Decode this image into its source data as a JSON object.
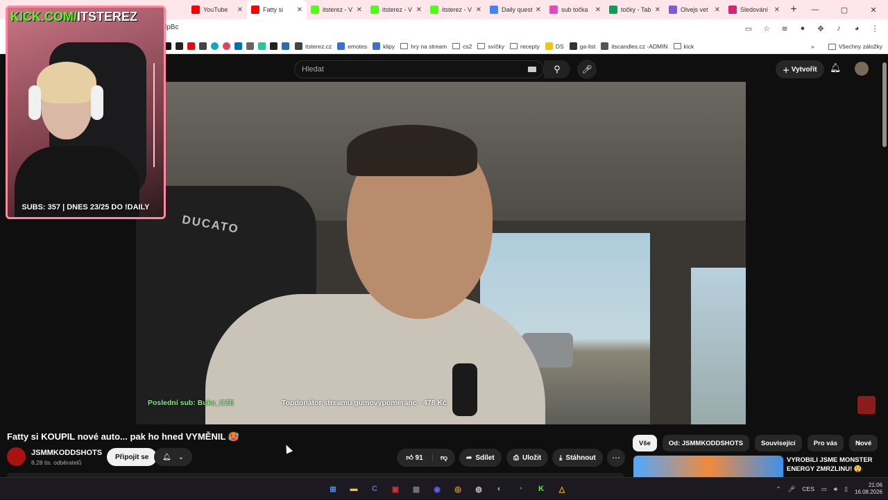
{
  "browser": {
    "tabs": [
      {
        "label": "YouTube",
        "icon": "youtube-icon",
        "color": "#ff0000",
        "active": false
      },
      {
        "label": "Fatty si",
        "icon": "youtube-icon",
        "color": "#ff0000",
        "active": true
      },
      {
        "label": "itsterez - V",
        "icon": "kick-icon",
        "color": "#53fc18",
        "active": false
      },
      {
        "label": "itsterez - V",
        "icon": "kick-icon",
        "color": "#53fc18",
        "active": false
      },
      {
        "label": "itsterez - V",
        "icon": "kick-icon",
        "color": "#53fc18",
        "active": false
      },
      {
        "label": "Daily quest",
        "icon": "docs-icon",
        "color": "#4285f4",
        "active": false
      },
      {
        "label": "sub točka",
        "icon": "sheets-icon",
        "color": "#e04ab5",
        "active": false
      },
      {
        "label": "točky - Tab",
        "icon": "sheets-icon",
        "color": "#0f9d58",
        "active": false
      },
      {
        "label": "Olvejs vet",
        "icon": "twitch-icon",
        "color": "#7b5cd6",
        "active": false
      },
      {
        "label": "Sledování",
        "icon": "tab-icon",
        "color": "#d6246e",
        "active": false
      }
    ],
    "url_fragment": "lpBc",
    "bookmarks": [
      {
        "label": "itsterez.cz",
        "type": "site",
        "color": "#444"
      },
      {
        "label": "emotes",
        "type": "site",
        "color": "#3a6fd8"
      },
      {
        "label": "klipy",
        "type": "site",
        "color": "#3a6fd8"
      },
      {
        "label": "hry na stream",
        "type": "folder"
      },
      {
        "label": "cs2",
        "type": "folder"
      },
      {
        "label": "svíčky",
        "type": "folder"
      },
      {
        "label": "recepty",
        "type": "folder"
      },
      {
        "label": "DS",
        "type": "site",
        "color": "#f1c40f"
      },
      {
        "label": "ga-list",
        "type": "site",
        "color": "#333"
      },
      {
        "label": "itscandles.cz -ADMIN",
        "type": "site",
        "color": "#555"
      },
      {
        "label": "kick",
        "type": "folder"
      }
    ],
    "all_bookmarks_label": "Všechny záložky"
  },
  "youtube": {
    "search_placeholder": "Hledat",
    "create_label": "Vytvořit"
  },
  "overlay": {
    "kick_handle_prefix": "KICK.COM/",
    "kick_handle_name": "ITSTEREZ",
    "subs_line": "SUBS: 357 | DNES 23/25 DO !DAILY",
    "last_sub_label": "Poslední sub:",
    "last_sub_name": "Buka_CZE",
    "top_donator": "Topdonátor streamu gumovypomeranc - 478 Kč",
    "seat_text": "DUCATO"
  },
  "video": {
    "title": "Fatty si KOUPIL nové auto... pak ho hned VYMĚNIL 🥵",
    "channel_name": "JSMMKODDSHOTS",
    "subscribers": "8,28 tis. odběratelů",
    "join_label": "Připojit se",
    "like_count": "91",
    "share_label": "Sdílet",
    "save_label": "Uložit",
    "download_label": "Stáhnout"
  },
  "chips": [
    "Vše",
    "Od: JSMMKODDSHOTS",
    "Související",
    "Pro vás",
    "Nové"
  ],
  "recommendation": {
    "title": "VYROBILI JSME MONSTER ENERGY ZMRZLINU! 😲"
  },
  "taskbar": {
    "apps": [
      {
        "name": "windows-start-icon",
        "glyph": "⊞",
        "color": "#4fa3ff"
      },
      {
        "name": "file-explorer-icon",
        "glyph": "▬",
        "color": "#f4c542"
      },
      {
        "name": "cursor-app-icon",
        "glyph": "C",
        "color": "#4a7bd8"
      },
      {
        "name": "terminal-icon",
        "glyph": "▣",
        "color": "#c33"
      },
      {
        "name": "minecraft-icon",
        "glyph": "▦",
        "color": "#777"
      },
      {
        "name": "discord-icon",
        "glyph": "◉",
        "color": "#5865f2"
      },
      {
        "name": "chrome-icon",
        "glyph": "◎",
        "color": "#e8a33d"
      },
      {
        "name": "obs-icon",
        "glyph": "◍",
        "color": "#bbb"
      },
      {
        "name": "steam-icon",
        "glyph": "◐",
        "color": "#6ab0de"
      },
      {
        "name": "spotify-icon",
        "glyph": "◔",
        "color": "#1db954"
      },
      {
        "name": "kick-app-icon",
        "glyph": "K",
        "color": "#53fc18"
      },
      {
        "name": "drive-icon",
        "glyph": "△",
        "color": "#f4b400"
      }
    ],
    "language": "CES",
    "time": "21:06",
    "date": "16.08.2026"
  }
}
